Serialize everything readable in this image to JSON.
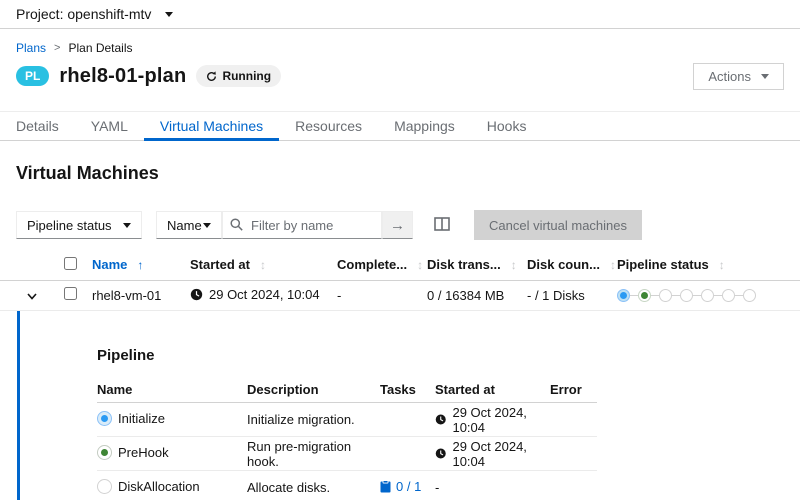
{
  "colors": {
    "accent_blue": "#0066cc",
    "badge_cyan": "#29c0e2",
    "success_green": "#3e8635",
    "running_blue": "#2b9af3",
    "disabled_gray": "#d2d2d2"
  },
  "masthead": {
    "project": "Project: openshift-mtv"
  },
  "breadcrumb": {
    "plans": "Plans",
    "current": "Plan Details"
  },
  "header": {
    "badge": "PL",
    "title": "rhel8-01-plan",
    "status": "Running",
    "actions": "Actions"
  },
  "tabs": [
    {
      "label": "Details"
    },
    {
      "label": "YAML"
    },
    {
      "label": "Virtual Machines"
    },
    {
      "label": "Resources"
    },
    {
      "label": "Mappings"
    },
    {
      "label": "Hooks"
    }
  ],
  "page": {
    "section_title": "Virtual Machines"
  },
  "toolbar": {
    "status_filter": "Pipeline status",
    "attr_filter": "Name",
    "search_placeholder": "Filter by name",
    "go_arrow": "→",
    "cancel_button": "Cancel virtual machines"
  },
  "vm_table": {
    "headers": {
      "name": "Name",
      "started": "Started at",
      "completed": "Complete...",
      "disk_transfer": "Disk trans...",
      "disk_counter": "Disk coun...",
      "pipeline_status": "Pipeline status"
    },
    "sort_up": "↑",
    "sort_both": "↕",
    "row": {
      "name": "rhel8-vm-01",
      "started_at": "29 Oct 2024, 10:04",
      "completed_at": "-",
      "disk_transfer": "0 / 16384 MB",
      "disk_counter": "- / 1 Disks",
      "pipeline_steps": [
        "running",
        "success",
        "pending",
        "pending",
        "pending",
        "pending",
        "pending"
      ]
    }
  },
  "pipeline": {
    "title": "Pipeline",
    "headers": {
      "name": "Name",
      "description": "Description",
      "tasks": "Tasks",
      "started": "Started at",
      "error": "Error"
    },
    "rows": [
      {
        "status": "running",
        "name": "Initialize",
        "description": "Initialize migration.",
        "tasks": "",
        "started_at": "29 Oct 2024, 10:04",
        "error": ""
      },
      {
        "status": "success",
        "name": "PreHook",
        "description": "Run pre-migration hook.",
        "tasks": "",
        "started_at": "29 Oct 2024, 10:04",
        "error": ""
      },
      {
        "status": "pending",
        "name": "DiskAllocation",
        "description": "Allocate disks.",
        "tasks": "0 / 1",
        "started_at": "-",
        "error": ""
      }
    ]
  }
}
